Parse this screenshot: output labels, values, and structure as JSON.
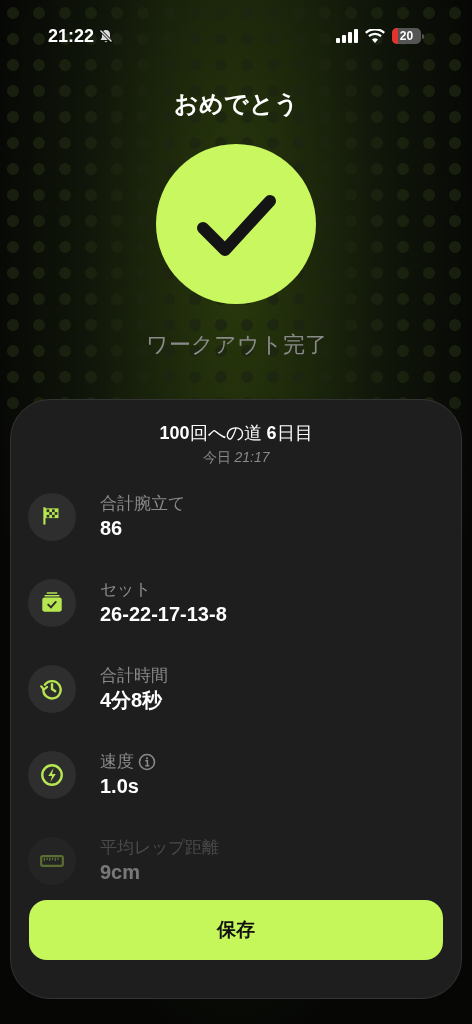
{
  "status_bar": {
    "time": "21:22",
    "silent": true,
    "battery": "20"
  },
  "title": "おめでとう",
  "subtitle": "ワークアウト完了",
  "summary": {
    "title": "**100**回への道 **6**日目",
    "date": "今日 *21:17*",
    "stats": [
      {
        "kind": "flag",
        "label": "合計腕立て",
        "value": "86",
        "info": false,
        "faded": false
      },
      {
        "kind": "sets",
        "label": "セット",
        "value": "26-22-17-13-8",
        "info": false,
        "faded": false
      },
      {
        "kind": "clock",
        "label": "合計時間",
        "value": "4分8秒",
        "info": false,
        "faded": false
      },
      {
        "kind": "bolt",
        "label": "速度",
        "value": "1.0s",
        "info": true,
        "faded": false
      },
      {
        "kind": "ruler",
        "label": "平均レップ距離",
        "value": "9cm",
        "info": false,
        "faded": true
      }
    ]
  },
  "save_button": "保存"
}
